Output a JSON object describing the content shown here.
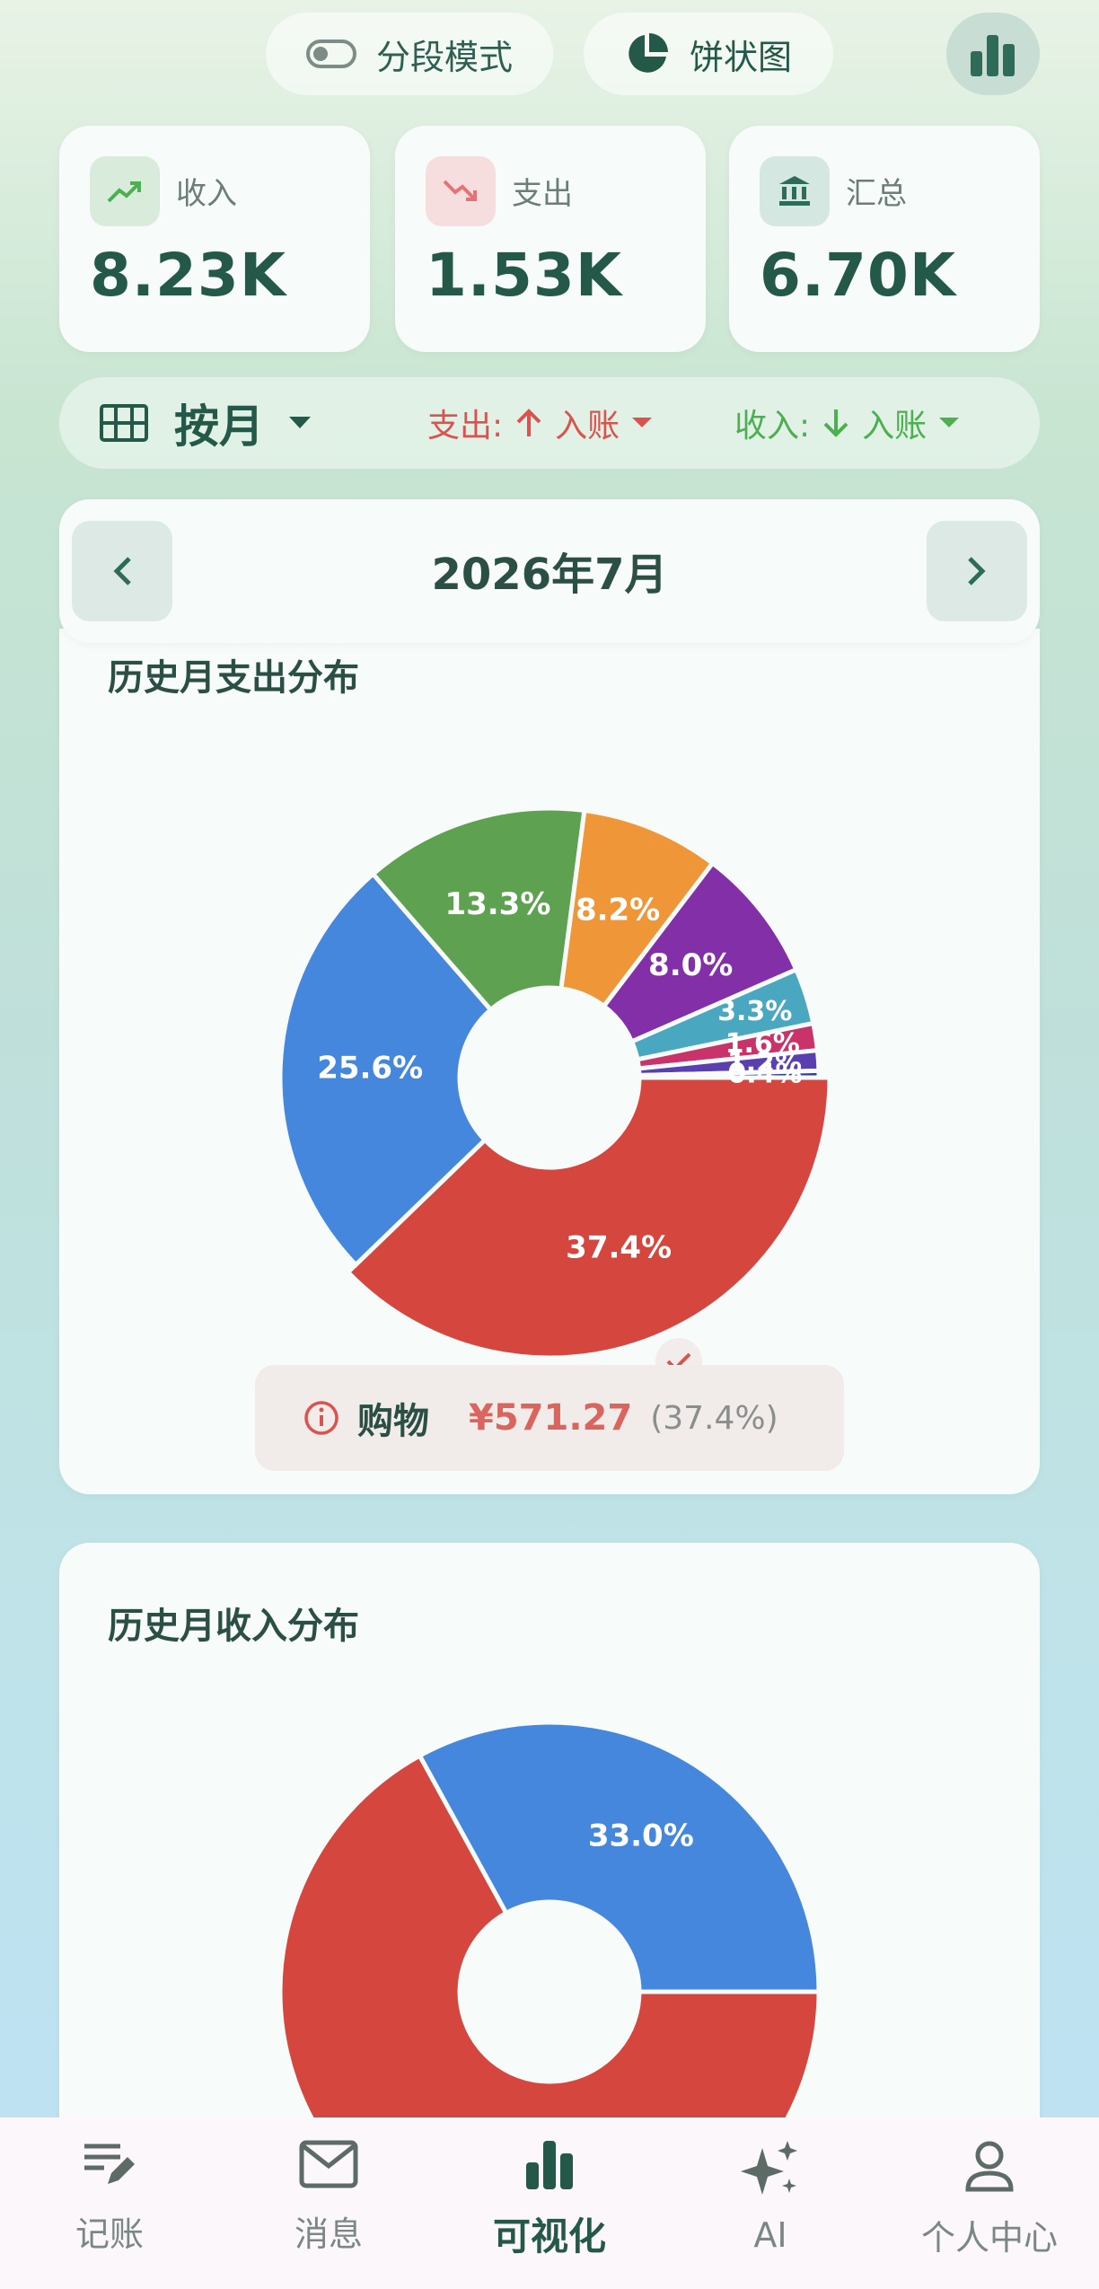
{
  "top": {
    "segment_label": "分段模式",
    "pie_label": "饼状图"
  },
  "stats": [
    {
      "label": "收入",
      "value": "8.23K",
      "icon": "trending-up-icon",
      "color": "#4caf50"
    },
    {
      "label": "支出",
      "value": "1.53K",
      "icon": "trending-down-icon",
      "color": "#e57373"
    },
    {
      "label": "汇总",
      "value": "6.70K",
      "icon": "bank-icon",
      "color": "#2e6b58"
    }
  ],
  "filter": {
    "period": "按月",
    "expense_label": "支出:",
    "expense_mode": "入账",
    "income_label": "收入:",
    "income_mode": "入账"
  },
  "month": {
    "label": "2026年7月"
  },
  "expense_card": {
    "title": "历史月支出分布",
    "tooltip": {
      "category": "购物",
      "amount": "¥571.27",
      "percent": "(37.4%)"
    }
  },
  "income_card": {
    "title": "历史月收入分布"
  },
  "chart_data": [
    {
      "type": "pie",
      "title": "历史月支出分布",
      "donut": true,
      "slices": [
        {
          "label": "37.4%",
          "value": 37.4,
          "color": "#d5463e"
        },
        {
          "label": "25.6%",
          "value": 25.6,
          "color": "#4487dd"
        },
        {
          "label": "13.3%",
          "value": 13.3,
          "color": "#5ea151"
        },
        {
          "label": "8.2%",
          "value": 8.2,
          "color": "#ef9638"
        },
        {
          "label": "8.0%",
          "value": 8.0,
          "color": "#8330a8"
        },
        {
          "label": "3.3%",
          "value": 3.3,
          "color": "#49a8c0"
        },
        {
          "label": "1.6%",
          "value": 1.6,
          "color": "#c9336a"
        },
        {
          "label": "1.2%",
          "value": 1.2,
          "color": "#5a3fb0"
        },
        {
          "label": "0.4%",
          "value": 0.4,
          "color": "#2f3d9a"
        }
      ]
    },
    {
      "type": "pie",
      "title": "历史月收入分布",
      "donut": true,
      "slices": [
        {
          "label": "",
          "value": 67.0,
          "color": "#d5463e"
        },
        {
          "label": "33.0%",
          "value": 33.0,
          "color": "#4487dd"
        }
      ]
    }
  ],
  "nav": [
    {
      "label": "记账",
      "icon": "edit-note-icon",
      "active": false
    },
    {
      "label": "消息",
      "icon": "mail-icon",
      "active": false
    },
    {
      "label": "可视化",
      "icon": "bar-chart-icon",
      "active": true
    },
    {
      "label": "AI",
      "icon": "sparkle-icon",
      "active": false
    },
    {
      "label": "个人中心",
      "icon": "person-icon",
      "active": false
    }
  ]
}
